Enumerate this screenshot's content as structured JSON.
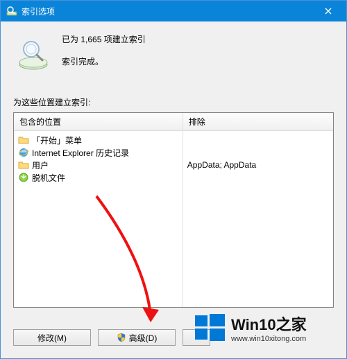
{
  "title": "索引选项",
  "status": {
    "count_line": "已为 1,665 项建立索引",
    "done_line": "索引完成。"
  },
  "section_label": "为这些位置建立索引:",
  "columns": {
    "included_header": "包含的位置",
    "excluded_header": "排除"
  },
  "included": [
    {
      "icon": "folder",
      "label": "「开始」菜单"
    },
    {
      "icon": "ie",
      "label": "Internet Explorer 历史记录"
    },
    {
      "icon": "folder",
      "label": "用户"
    },
    {
      "icon": "offline",
      "label": "脱机文件"
    }
  ],
  "excluded": [
    "",
    "",
    "AppData; AppData",
    ""
  ],
  "buttons": {
    "modify": "修改(M)",
    "advanced": "高级(D)"
  },
  "watermark": {
    "brand": "Win10之家",
    "url": "www.win10xitong.com"
  }
}
